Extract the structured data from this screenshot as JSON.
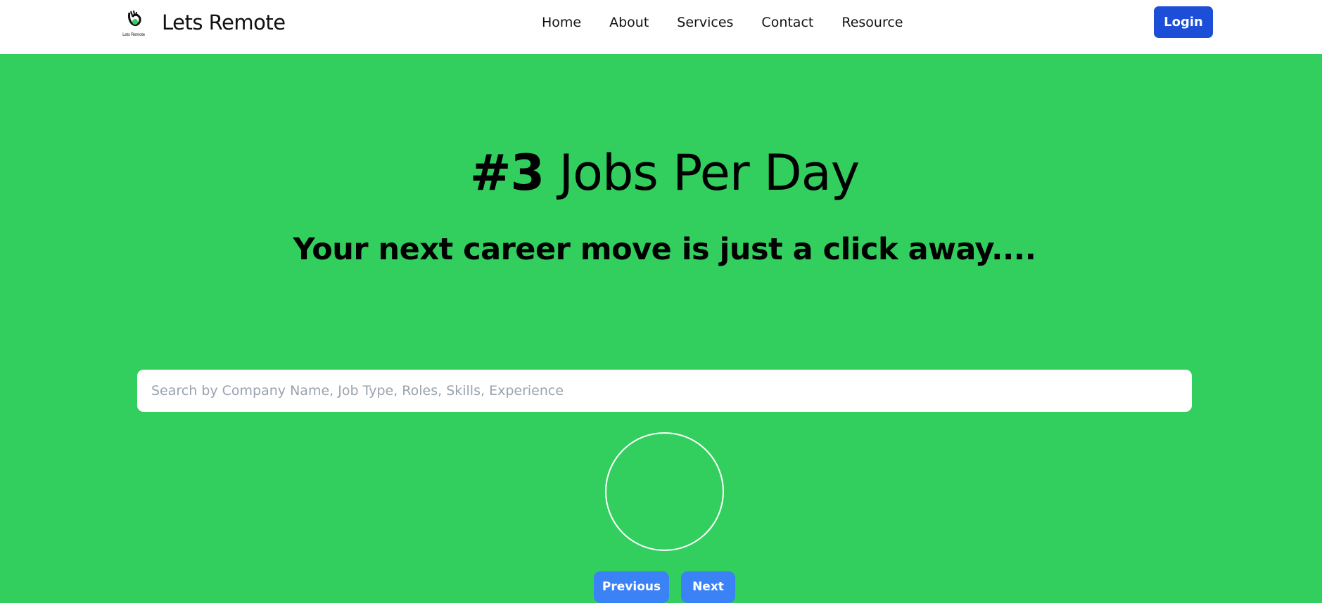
{
  "header": {
    "brand_name": "Lets Remote",
    "logo_caption": "Lets Remote",
    "nav": [
      {
        "label": "Home"
      },
      {
        "label": "About"
      },
      {
        "label": "Services"
      },
      {
        "label": "Contact"
      },
      {
        "label": "Resource"
      }
    ],
    "login_label": "Login",
    "login_color": "#1d4ed8"
  },
  "hero": {
    "title_strong": "#3",
    "title_rest": "Jobs Per Day",
    "subtitle": "Your next career move is just a click away....",
    "background_color": "#33cf5e"
  },
  "search": {
    "placeholder": "Search by Company Name, Job Type, Roles, Skills, Experience",
    "value": ""
  },
  "pagination": {
    "previous_label": "Previous",
    "next_label": "Next",
    "button_color": "#3b82f6"
  },
  "icons": {
    "logo": "lets-remote-logo-icon",
    "loader": "loading-spinner-icon"
  }
}
